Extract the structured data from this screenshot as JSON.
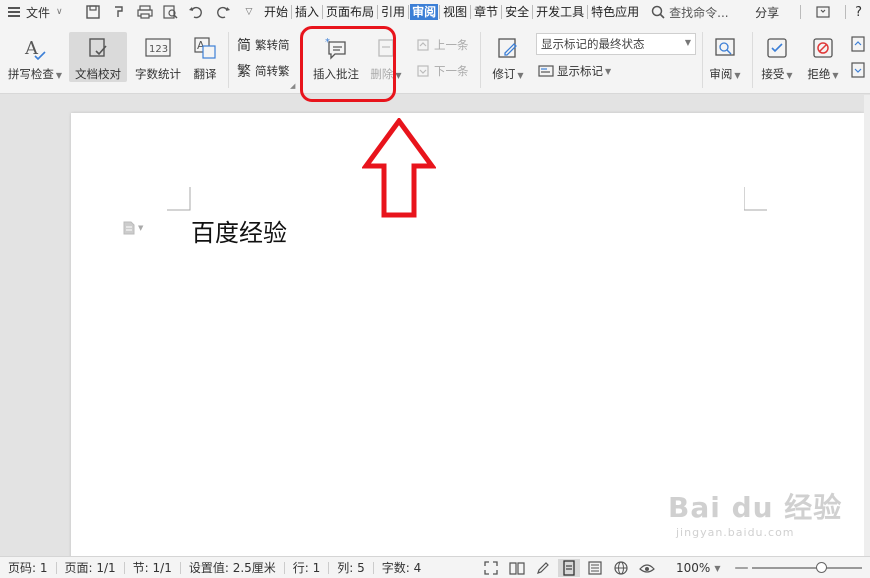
{
  "menubar": {
    "menu_icon": "hamburger-icon",
    "file_label": "文件",
    "tabs": [
      {
        "label": "开始"
      },
      {
        "label": "插入"
      },
      {
        "label": "页面布局"
      },
      {
        "label": "引用"
      },
      {
        "label": "审阅",
        "active": true
      },
      {
        "label": "视图"
      },
      {
        "label": "章节"
      },
      {
        "label": "安全"
      },
      {
        "label": "开发工具"
      },
      {
        "label": "特色应用"
      }
    ],
    "search_label": "查找命令...",
    "share_label": "分享",
    "help_label": "?"
  },
  "ribbon": {
    "spell_check": "拼写检查",
    "doc_proof": "文档校对",
    "word_count": "字数统计",
    "translate": "翻译",
    "trad_to_simp": "繁转简",
    "simp_to_trad": "简转繁",
    "insert_comment": "插入批注",
    "delete": "删除",
    "prev_item": "上一条",
    "next_item": "下一条",
    "track_changes": "修订",
    "markup_state": "显示标记的最终状态",
    "show_markup": "显示标记",
    "review": "审阅",
    "accept": "接受",
    "reject": "拒绝",
    "char_simp": "简",
    "char_trad": "繁"
  },
  "document": {
    "text": "百度经验"
  },
  "statusbar": {
    "page_num": "页码: 1",
    "pages": "页面: 1/1",
    "section": "节: 1/1",
    "position": "设置值: 2.5厘米",
    "row": "行: 1",
    "col": "列: 5",
    "char_count": "字数: 4",
    "zoom": "100%",
    "zoom_level": 1.0
  },
  "watermark": {
    "brand": "Bai du 经验",
    "url": "jingyan.baidu.com"
  },
  "colors": {
    "accent": "#3c7fd6",
    "highlight": "#e8141c"
  }
}
